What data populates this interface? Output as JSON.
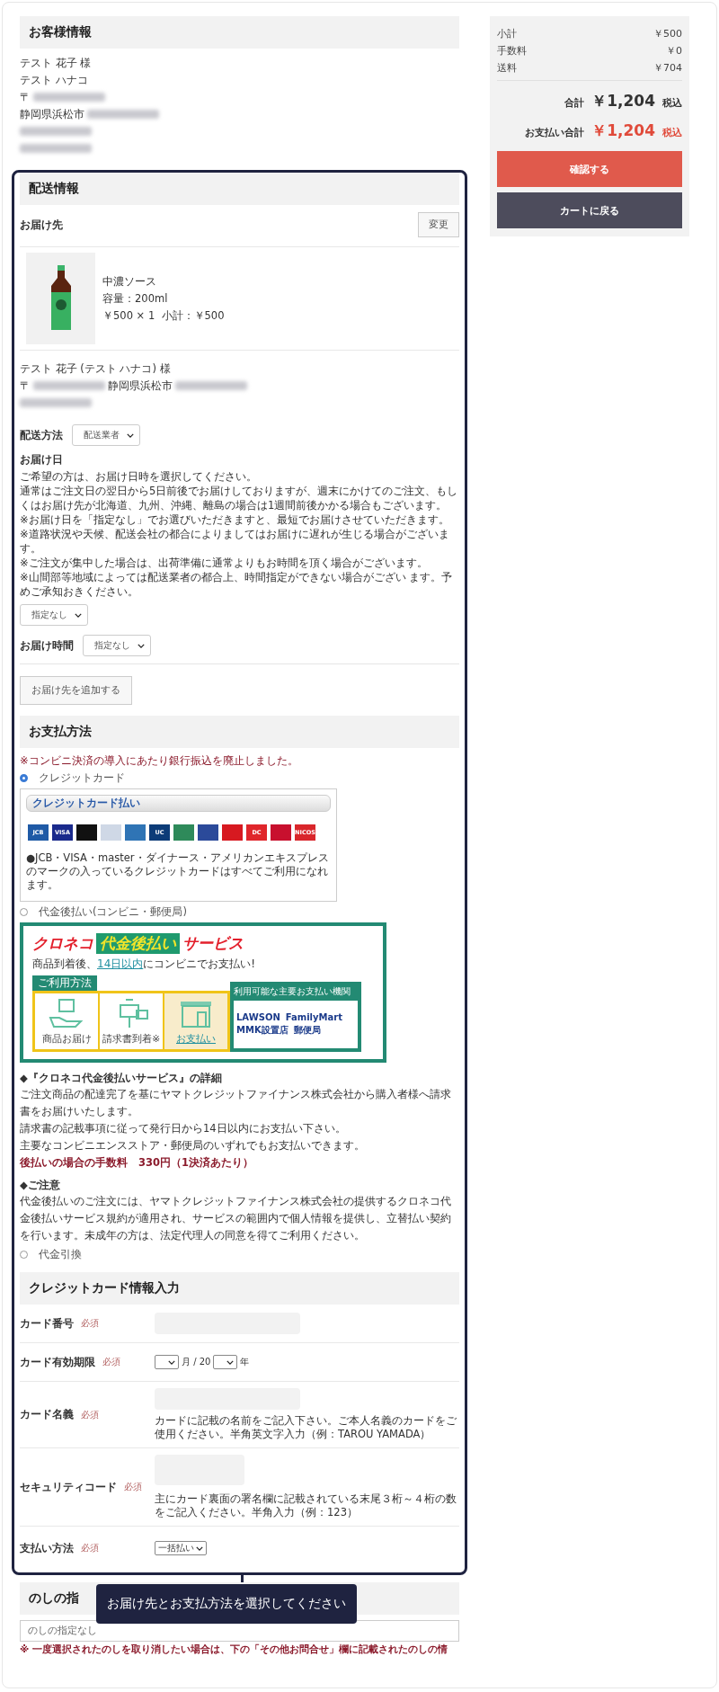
{
  "customer": {
    "title": "お客様情報",
    "lines": [
      [
        {
          "kind": "text",
          "text": "テスト 花子 様"
        }
      ],
      [
        {
          "kind": "text",
          "text": "テスト ハナコ"
        }
      ],
      [
        {
          "kind": "text",
          "text": "〒"
        },
        {
          "kind": "redacted"
        }
      ],
      [
        {
          "kind": "text",
          "text": "静岡県浜松市"
        },
        {
          "kind": "redacted"
        }
      ],
      [
        {
          "kind": "redacted"
        }
      ],
      [
        {
          "kind": "redacted"
        }
      ]
    ]
  },
  "summary": {
    "rows": [
      {
        "label": "小計",
        "value": "￥500"
      },
      {
        "label": "手数料",
        "value": "￥0"
      },
      {
        "label": "送料",
        "value": "￥704"
      }
    ],
    "totals": [
      {
        "label": "合計",
        "amount": "￥1,204",
        "tax": "税込",
        "kind": "plain"
      },
      {
        "label": "お支払い合計",
        "amount": "￥1,204",
        "tax": "税込",
        "kind": "accent"
      }
    ],
    "buttons": [
      {
        "label": "確認する",
        "kind": "primary"
      },
      {
        "label": "カートに戻る",
        "kind": "secondary"
      }
    ]
  },
  "shipping": {
    "title": "配送情報",
    "destination_label": "お届け先",
    "change_button": "変更",
    "product": {
      "name": "中濃ソース",
      "volume": "容量：200ml",
      "price_line": "￥500 × 1  小計：￥500"
    },
    "recipient": [
      [
        {
          "kind": "text",
          "text": "テスト 花子 (テスト ハナコ) 様"
        }
      ],
      [
        {
          "kind": "text",
          "text": "〒"
        },
        {
          "kind": "redacted"
        },
        {
          "kind": "text",
          "text": "静岡県浜松市"
        },
        {
          "kind": "redacted"
        }
      ],
      [
        {
          "kind": "redacted"
        }
      ]
    ],
    "method": {
      "label": "配送方法",
      "value": "配送業者"
    },
    "date": {
      "label": "お届け日",
      "notes": [
        "ご希望の方は、お届け日時を選択してください。",
        "通常はご注文日の翌日から5日前後でお届けしておりますが、週末にかけてのご注文、もしくはお届け先が北海道、九州、沖縄、離島の場合は1週間前後かかる場合もございます。",
        "※お届け日を「指定なし」でお選びいただきますと、最短でお届けさせていただきます。",
        "※道路状況や天候、配送会社の都合によりましてはお届けに遅れが生じる場合がございます。",
        "※ご注文が集中した場合は、出荷準備に通常よりもお時間を頂く場合がございます。",
        "※山間部等地域によっては配送業者の都合上、時間指定ができない場合がござい ます。予めご承知おきください。"
      ],
      "value": "指定なし"
    },
    "time": {
      "label": "お届け時間",
      "value": "指定なし"
    },
    "add_button": "お届け先を追加する"
  },
  "payment": {
    "title": "お支払方法",
    "notice": "※コンビニ決済の導入にあたり銀行振込を廃止しました。",
    "options": [
      {
        "kind": "credit",
        "label": "クレジットカード",
        "selected": true
      },
      {
        "kind": "deferred",
        "label": "代金後払い(コンビニ・郵便局)",
        "selected": false
      },
      {
        "kind": "cod",
        "label": "代金引換",
        "selected": false
      }
    ],
    "credit_panel": {
      "title": "クレジットカード払い",
      "brands": [
        {
          "label": "JCB",
          "color": "#1f5aa6"
        },
        {
          "label": "VISA",
          "color": "#1a2a8c"
        },
        {
          "color": "#111111"
        },
        {
          "color": "#cfd8e6"
        },
        {
          "color": "#2f74b5"
        },
        {
          "label": "UC",
          "color": "#0d3c78"
        },
        {
          "color": "#2e8a5a"
        },
        {
          "color": "#2b4a9a"
        },
        {
          "color": "#d71920"
        },
        {
          "label": "DC",
          "color": "#e0262b"
        },
        {
          "color": "#c8102e"
        },
        {
          "label": "NICOS",
          "color": "#d9262b"
        }
      ],
      "note": "●JCB・VISA・master・ダイナース・アメリカンエキスプレスのマークの入っているクレジットカードはすべてご利用になれます。"
    },
    "banner": {
      "brand": "クロネコ",
      "service": "代金後払い",
      "suffix": "サービス",
      "tagline_before": "商品到着後、",
      "tagline_link": "14日以内",
      "tagline_after": "にコンビニでお支払い!",
      "usage_label": "ご利用方法",
      "steps": [
        {
          "label": "商品お届け",
          "highlighted": false,
          "kind": "parcel"
        },
        {
          "label": "請求書到着※",
          "highlighted": false,
          "kind": "mailbox"
        },
        {
          "label": "お支払い",
          "highlighted": true,
          "kind": "store"
        }
      ],
      "institutions_title": "利用可能な主要お支払い機関",
      "institutions": [
        "LAWSON",
        "FamilyMart",
        "MMK設置店",
        "郵便局"
      ]
    },
    "details_title": "◆『クロネコ代金後払いサービス』の詳細",
    "details": [
      "ご注文商品の配達完了を基にヤマトクレジットファイナンス株式会社から購入者様へ請求書をお届けいたします。",
      "請求書の記載事項に従って発行日から14日以内にお支払い下さい。",
      "主要なコンビニエンスストア・郵便局のいずれでもお支払いできます。"
    ],
    "fee": "後払いの場合の手数料　330円（1決済あたり）",
    "caution_title": "◆ご注意",
    "caution": "代金後払いのご注文には、ヤマトクレジットファイナンス株式会社の提供するクロネコ代金後払いサービス規約が適用され、サービスの範囲内で個人情報を提供し、立替払い契約を行います。未成年の方は、法定代理人の同意を得てご利用ください。"
  },
  "card_form": {
    "title": "クレジットカード情報入力",
    "rows": [
      {
        "kind": "text",
        "label": "カード番号",
        "required": "必須"
      },
      {
        "kind": "expiry",
        "label": "カード有効期限",
        "required": "必須",
        "separator": "月 / 20",
        "suffix": "年"
      },
      {
        "kind": "text",
        "label": "カード名義",
        "required": "必須",
        "note": "カードに記載の名前をご記入下さい。ご本人名義のカードをご使用ください。半角英文字入力（例：TAROU YAMADA）"
      },
      {
        "kind": "short",
        "label": "セキュリティコード",
        "required": "必須",
        "note": "主にカード裏面の署名欄に記載されている末尾３桁～４桁の数をご記入ください。半角入力（例：123）"
      },
      {
        "kind": "select",
        "label": "支払い方法",
        "required": "必須",
        "value": "一括払い"
      }
    ]
  },
  "noshi": {
    "title": "のしの指",
    "value": "のしの指定なし",
    "warning": "※ 一度選択されたのしを取り消したい場合は、下の「その他お問合せ」欄に記載されたのしの情"
  },
  "tooltip": "お届け先とお支払方法を選択してください"
}
